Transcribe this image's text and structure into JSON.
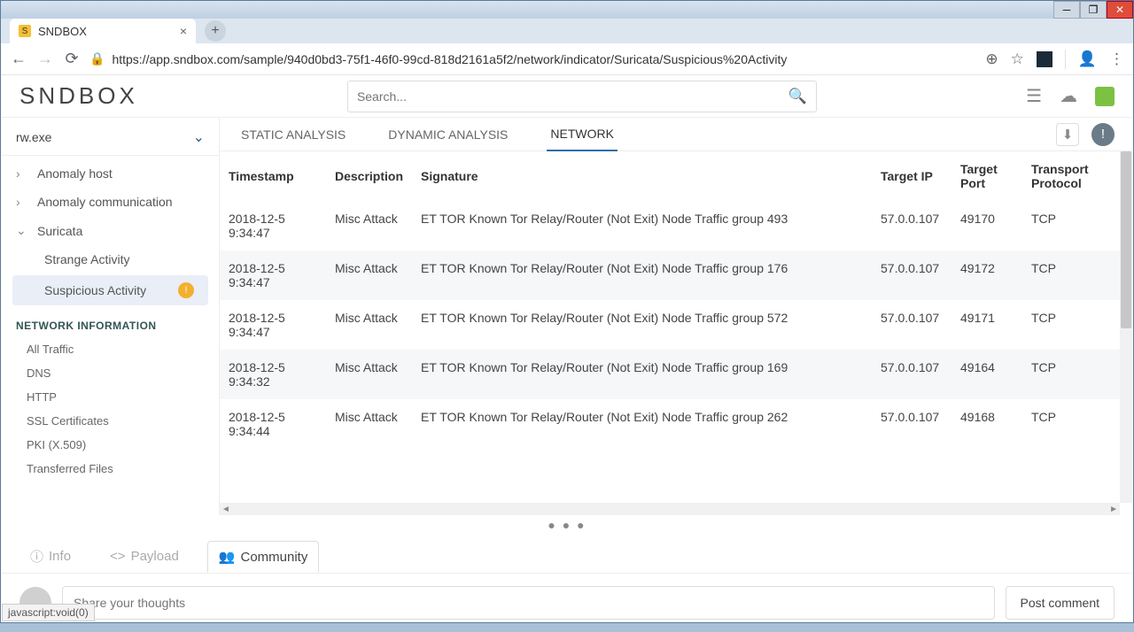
{
  "window": {
    "tab_title": "SNDBOX"
  },
  "address_bar": {
    "url": "https://app.sndbox.com/sample/940d0bd3-75f1-46f0-99cd-818d2161a5f2/network/indicator/Suricata/Suspicious%20Activity"
  },
  "app": {
    "brand": "SNDBOX",
    "search_placeholder": "Search...",
    "file_name": "rw.exe",
    "sidebar": {
      "anomaly_host": "Anomaly host",
      "anomaly_comm": "Anomaly communication",
      "suricata": "Suricata",
      "strange": "Strange Activity",
      "suspicious": "Suspicious Activity",
      "badge": "!",
      "net_info_head": "NETWORK INFORMATION",
      "links": [
        "All Traffic",
        "DNS",
        "HTTP",
        "SSL Certificates",
        "PKI (X.509)",
        "Transferred Files"
      ]
    },
    "tabs": {
      "static": "STATIC ANALYSIS",
      "dynamic": "DYNAMIC ANALYSIS",
      "network": "NETWORK"
    },
    "table": {
      "cols": [
        "Timestamp",
        "Description",
        "Signature",
        "Target IP",
        "Target Port",
        "Transport Protocol"
      ],
      "rows": [
        {
          "ts": "2018-12-5 9:34:47",
          "desc": "Misc Attack",
          "sig": "ET TOR Known Tor Relay/Router (Not Exit) Node Traffic group 493",
          "ip": "57.0.0.107",
          "port": "49170",
          "proto": "TCP"
        },
        {
          "ts": "2018-12-5 9:34:47",
          "desc": "Misc Attack",
          "sig": "ET TOR Known Tor Relay/Router (Not Exit) Node Traffic group 176",
          "ip": "57.0.0.107",
          "port": "49172",
          "proto": "TCP"
        },
        {
          "ts": "2018-12-5 9:34:47",
          "desc": "Misc Attack",
          "sig": "ET TOR Known Tor Relay/Router (Not Exit) Node Traffic group 572",
          "ip": "57.0.0.107",
          "port": "49171",
          "proto": "TCP"
        },
        {
          "ts": "2018-12-5 9:34:32",
          "desc": "Misc Attack",
          "sig": "ET TOR Known Tor Relay/Router (Not Exit) Node Traffic group 169",
          "ip": "57.0.0.107",
          "port": "49164",
          "proto": "TCP"
        },
        {
          "ts": "2018-12-5 9:34:44",
          "desc": "Misc Attack",
          "sig": "ET TOR Known Tor Relay/Router (Not Exit) Node Traffic group 262",
          "ip": "57.0.0.107",
          "port": "49168",
          "proto": "TCP"
        }
      ]
    },
    "lower": {
      "info": "Info",
      "payload": "Payload",
      "community": "Community"
    },
    "comment": {
      "placeholder": "Share your thoughts",
      "post": "Post comment"
    }
  },
  "status": "javascript:void(0)"
}
